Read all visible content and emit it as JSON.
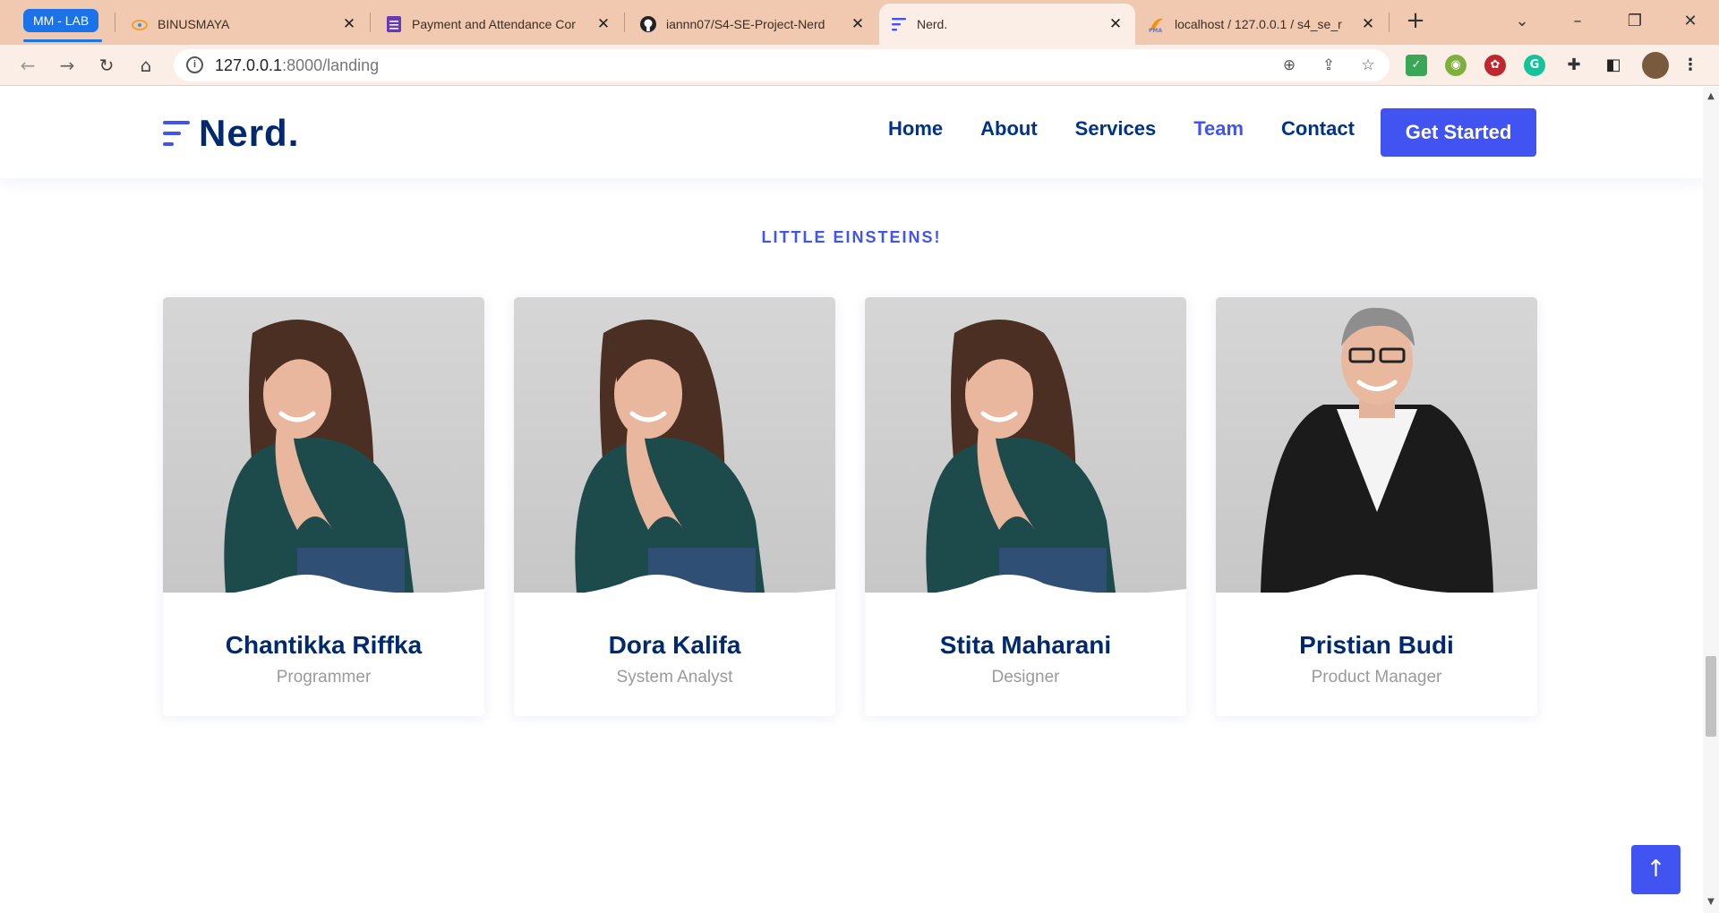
{
  "browser": {
    "tab_group": "MM - LAB",
    "tabs": [
      {
        "title": "BINUSMAYA",
        "icon": "binusmaya-favicon"
      },
      {
        "title": "Payment and Attendance Cor",
        "icon": "forms-favicon"
      },
      {
        "title": "iannn07/S4-SE-Project-Nerd",
        "icon": "github-favicon"
      },
      {
        "title": "Nerd.",
        "icon": "nerd-favicon",
        "active": true
      },
      {
        "title": "localhost / 127.0.0.1 / s4_se_r",
        "icon": "phpmyadmin-favicon"
      }
    ],
    "url_host": "127.0.0.1",
    "url_rest": ":8000/landing",
    "accent": "#1a73e8"
  },
  "site": {
    "logo": "Nerd.",
    "nav": [
      {
        "label": "Home"
      },
      {
        "label": "About"
      },
      {
        "label": "Services"
      },
      {
        "label": "Team",
        "active": true
      },
      {
        "label": "Contact"
      }
    ],
    "cta": "Get Started",
    "brand_color": "#4154f1",
    "text_color": "#012970"
  },
  "team": {
    "section_title": "LITTLE EINSTEINS!",
    "members": [
      {
        "name": "Chantikka Riffka",
        "role": "Programmer",
        "photo": "woman-portrait"
      },
      {
        "name": "Dora Kalifa",
        "role": "System Analyst",
        "photo": "woman-portrait"
      },
      {
        "name": "Stita Maharani",
        "role": "Designer",
        "photo": "woman-portrait"
      },
      {
        "name": "Pristian Budi",
        "role": "Product Manager",
        "photo": "man-portrait"
      }
    ]
  }
}
